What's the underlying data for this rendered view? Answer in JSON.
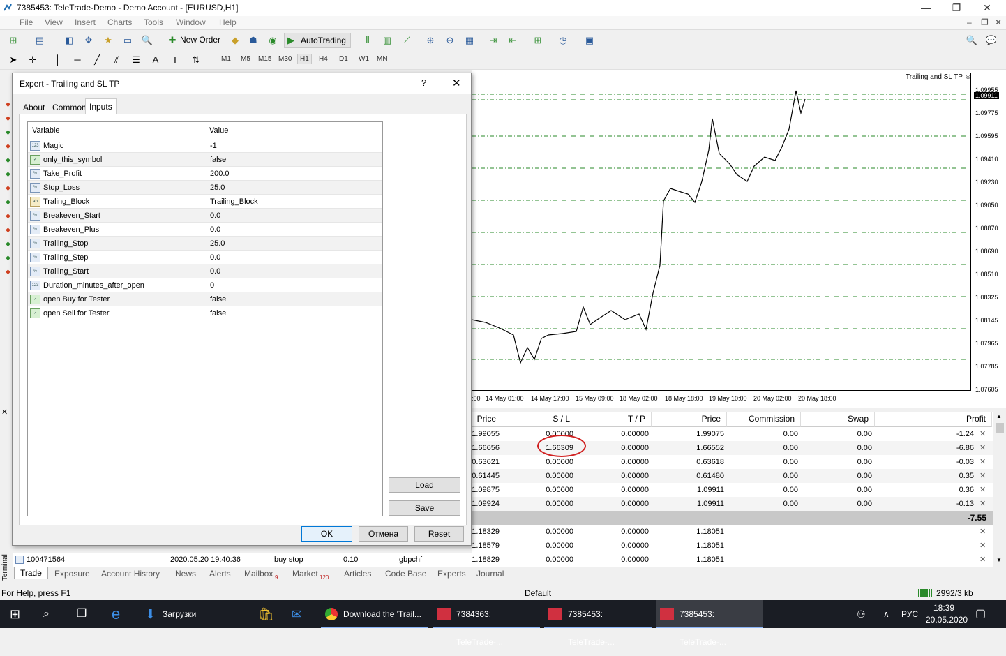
{
  "window": {
    "title": "7385453: TeleTrade-Demo - Demo Account - [EURUSD,H1]",
    "minimize": "—",
    "maximize": "❐",
    "close": "✕"
  },
  "menu": [
    "File",
    "View",
    "Insert",
    "Charts",
    "Tools",
    "Window",
    "Help"
  ],
  "toolbar": {
    "new_order": "New Order",
    "autotrading": "AutoTrading"
  },
  "timeframes": [
    "M1",
    "M5",
    "M15",
    "M30",
    "H1",
    "H4",
    "D1",
    "W1",
    "MN"
  ],
  "selected_timeframe": "H1",
  "chart": {
    "indicator_label": "Trailing and SL TP ☺",
    "current_price": "1.09911",
    "y_labels": [
      "1.09955",
      "1.09775",
      "1.09595",
      "1.09410",
      "1.09230",
      "1.09050",
      "1.08870",
      "1.08690",
      "1.08510",
      "1.08325",
      "1.08145",
      "1.07965",
      "1.07785",
      "1.07605"
    ],
    "x_labels": [
      ":00",
      "14 May 01:00",
      "14 May 17:00",
      "15 May 09:00",
      "18 May 02:00",
      "18 May 18:00",
      "19 May 10:00",
      "20 May 02:00",
      "20 May 18:00"
    ]
  },
  "trade": {
    "columns": [
      "Price",
      "S / L",
      "T / P",
      "Price",
      "Commission",
      "Swap",
      "Profit"
    ],
    "rows": [
      [
        "1.99055",
        "0.00000",
        "0.00000",
        "1.99075",
        "0.00",
        "0.00",
        "-1.24"
      ],
      [
        "1.66656",
        "1.66309",
        "0.00000",
        "1.66552",
        "0.00",
        "0.00",
        "-6.86"
      ],
      [
        "0.63621",
        "0.00000",
        "0.00000",
        "0.63618",
        "0.00",
        "0.00",
        "-0.03"
      ],
      [
        "0.61445",
        "0.00000",
        "0.00000",
        "0.61480",
        "0.00",
        "0.00",
        "0.35"
      ],
      [
        "1.09875",
        "0.00000",
        "0.00000",
        "1.09911",
        "0.00",
        "0.00",
        "0.36"
      ],
      [
        "1.09924",
        "0.00000",
        "0.00000",
        "1.09911",
        "0.00",
        "0.00",
        "-0.13"
      ]
    ],
    "total": "-7.55",
    "pending": [
      [
        "1.18329",
        "0.00000",
        "0.00000",
        "1.18051"
      ],
      [
        "1.18579",
        "0.00000",
        "0.00000",
        "1.18051"
      ],
      [
        "1.18829",
        "0.00000",
        "0.00000",
        "1.18051"
      ]
    ],
    "last_order": {
      "ticket": "100471564",
      "time": "2020.05.20 19:40:36",
      "type": "buy stop",
      "size": "0.10",
      "symbol": "gbpchf"
    }
  },
  "terminal_label": "Terminal",
  "bottom_tabs": [
    "Trade",
    "Exposure",
    "Account History",
    "News",
    "Alerts",
    "Mailbox",
    "Market",
    "Articles",
    "Code Base",
    "Experts",
    "Journal"
  ],
  "mailbox_count": "9",
  "market_count": "120",
  "status": {
    "help": "For Help, press F1",
    "profile": "Default",
    "traffic": "2992/3 kb"
  },
  "taskbar": {
    "downloads": "Загрузки",
    "chrome": "Download the 'Trail...",
    "mt1": "7384363: TeleTrade-...",
    "mt2": "7385453: TeleTrade-...",
    "mt3": "7385453: TeleTrade-...",
    "lang": "РУС",
    "time": "18:39",
    "date": "20.05.2020"
  },
  "dialog": {
    "title": "Expert - Trailing and SL TP",
    "help": "?",
    "close": "✕",
    "tabs": [
      "About",
      "Common",
      "Inputs"
    ],
    "selected_tab": "Inputs",
    "col_variable": "Variable",
    "col_value": "Value",
    "params": [
      {
        "type": "int",
        "name": "Magic",
        "value": "-1"
      },
      {
        "type": "bool",
        "name": "only_this_symbol",
        "value": "false"
      },
      {
        "type": "dbl",
        "name": "Take_Profit",
        "value": "200.0"
      },
      {
        "type": "dbl",
        "name": "Stop_Loss",
        "value": "25.0"
      },
      {
        "type": "str",
        "name": "Traling_Block",
        "value": "Trailing_Block"
      },
      {
        "type": "dbl",
        "name": "Breakeven_Start",
        "value": "0.0"
      },
      {
        "type": "dbl",
        "name": "Breakeven_Plus",
        "value": "0.0"
      },
      {
        "type": "dbl",
        "name": "Trailing_Stop",
        "value": "25.0"
      },
      {
        "type": "dbl",
        "name": "Trailing_Step",
        "value": "0.0"
      },
      {
        "type": "dbl",
        "name": "Trailing_Start",
        "value": "0.0"
      },
      {
        "type": "int",
        "name": "Duration_minutes_after_open",
        "value": "0"
      },
      {
        "type": "bool",
        "name": "open Buy for Tester",
        "value": "false"
      },
      {
        "type": "bool",
        "name": "open Sell for Tester",
        "value": "false"
      }
    ],
    "load": "Load",
    "save": "Save",
    "ok": "OK",
    "cancel": "Отмена",
    "reset": "Reset"
  }
}
